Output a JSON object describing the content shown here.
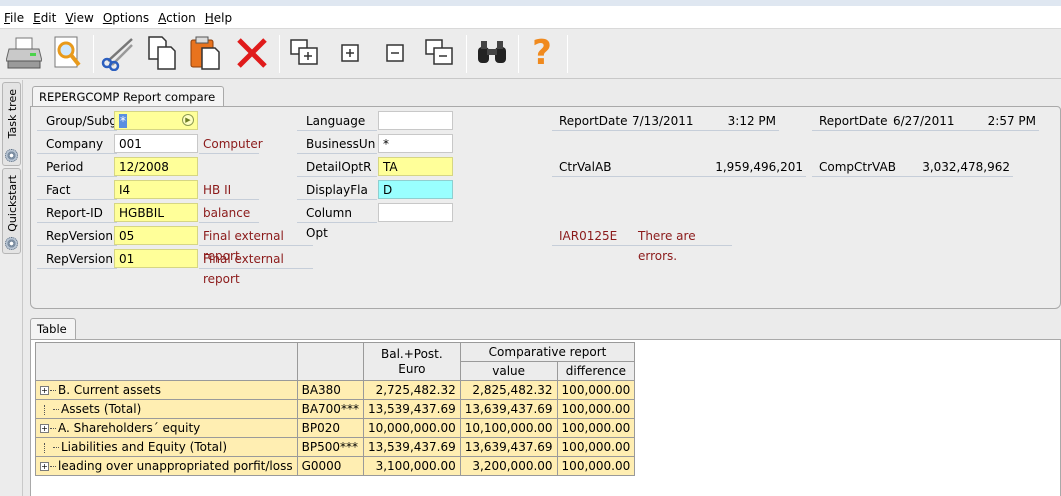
{
  "menu": [
    {
      "key": "F",
      "rest": "ile"
    },
    {
      "key": "E",
      "rest": "dit"
    },
    {
      "key": "V",
      "rest": "iew"
    },
    {
      "key": "O",
      "rest": "ptions"
    },
    {
      "key": "A",
      "rest": "ction"
    },
    {
      "key": "H",
      "rest": "elp"
    }
  ],
  "toolbar_icons": [
    "print-icon",
    "preview-icon",
    "cut-icon",
    "copy-icon",
    "paste-icon",
    "delete-icon",
    "expand-all-icon",
    "expand-icon",
    "collapse-icon",
    "collapse-all-icon",
    "find-icon",
    "help-icon"
  ],
  "side_tabs": {
    "task_tree": "Task tree",
    "quickstart": "Quickstart"
  },
  "report_tab": "REPERGCOMP Report compare",
  "form": {
    "group_label": "Group/Subg",
    "group_value": "*",
    "company_label": "Company",
    "company_value": "001",
    "company_desc": "Computer",
    "period_label": "Period",
    "period_value": "12/2008",
    "fact_label": "Fact",
    "fact_value": "I4",
    "fact_desc": "HB II",
    "report_id_label": "Report-ID",
    "report_id_value": "HGBBIL",
    "report_id_desc": "balance",
    "repversion1_label": "RepVersion",
    "repversion1_value": "05",
    "repversion1_desc": "Final external report",
    "repversion2_label": "RepVersion",
    "repversion2_value": "01",
    "repversion2_desc": "Final external report",
    "language_label": "Language",
    "language_value": "",
    "businessun_label": "BusinessUn",
    "businessun_value": "*",
    "detailopt_label": "DetailOptR",
    "detailopt_value": "TA",
    "displayfla_label": "DisplayFla",
    "displayfla_value": "D",
    "columnopt_label": "Column Opt",
    "columnopt_value": "",
    "reportdate1_label": "ReportDate",
    "reportdate1_date": "7/13/2011",
    "reportdate1_time": "3:12 PM",
    "reportdate2_label": "ReportDate",
    "reportdate2_date": "6/27/2011",
    "reportdate2_time": "2:57 PM",
    "ctrval_label": "CtrValAB",
    "ctrval_value": "1,959,496,201",
    "compctrval_label": "CompCtrVAB",
    "compctrval_value": "3,032,478,962",
    "error_code": "IAR0125E",
    "error_text": "There are errors."
  },
  "table_tab": "Table",
  "table": {
    "header_balpost": "Bal.+Post. Euro",
    "header_comparative": "Comparative report",
    "header_value": "value",
    "header_difference": "difference",
    "rows": [
      {
        "label": "B. Current assets",
        "code": "BA380",
        "bal": "2,725,482.32",
        "value": "2,825,482.32",
        "diff": "100,000.00"
      },
      {
        "label": "Assets (Total)",
        "code": "BA700***",
        "bal": "13,539,437.69",
        "value": "13,639,437.69",
        "diff": "100,000.00"
      },
      {
        "label": "A. Shareholders´ equity",
        "code": "BP020",
        "bal": "10,000,000.00",
        "value": "10,100,000.00",
        "diff": "100,000.00"
      },
      {
        "label": "Liabilities and Equity (Total)",
        "code": "BP500***",
        "bal": "13,539,437.69",
        "value": "13,639,437.69",
        "diff": "100,000.00"
      },
      {
        "label": "leading over unappropriated porfit/loss",
        "code": "G0000",
        "bal": "3,100,000.00",
        "value": "3,200,000.00",
        "diff": "100,000.00"
      }
    ]
  }
}
